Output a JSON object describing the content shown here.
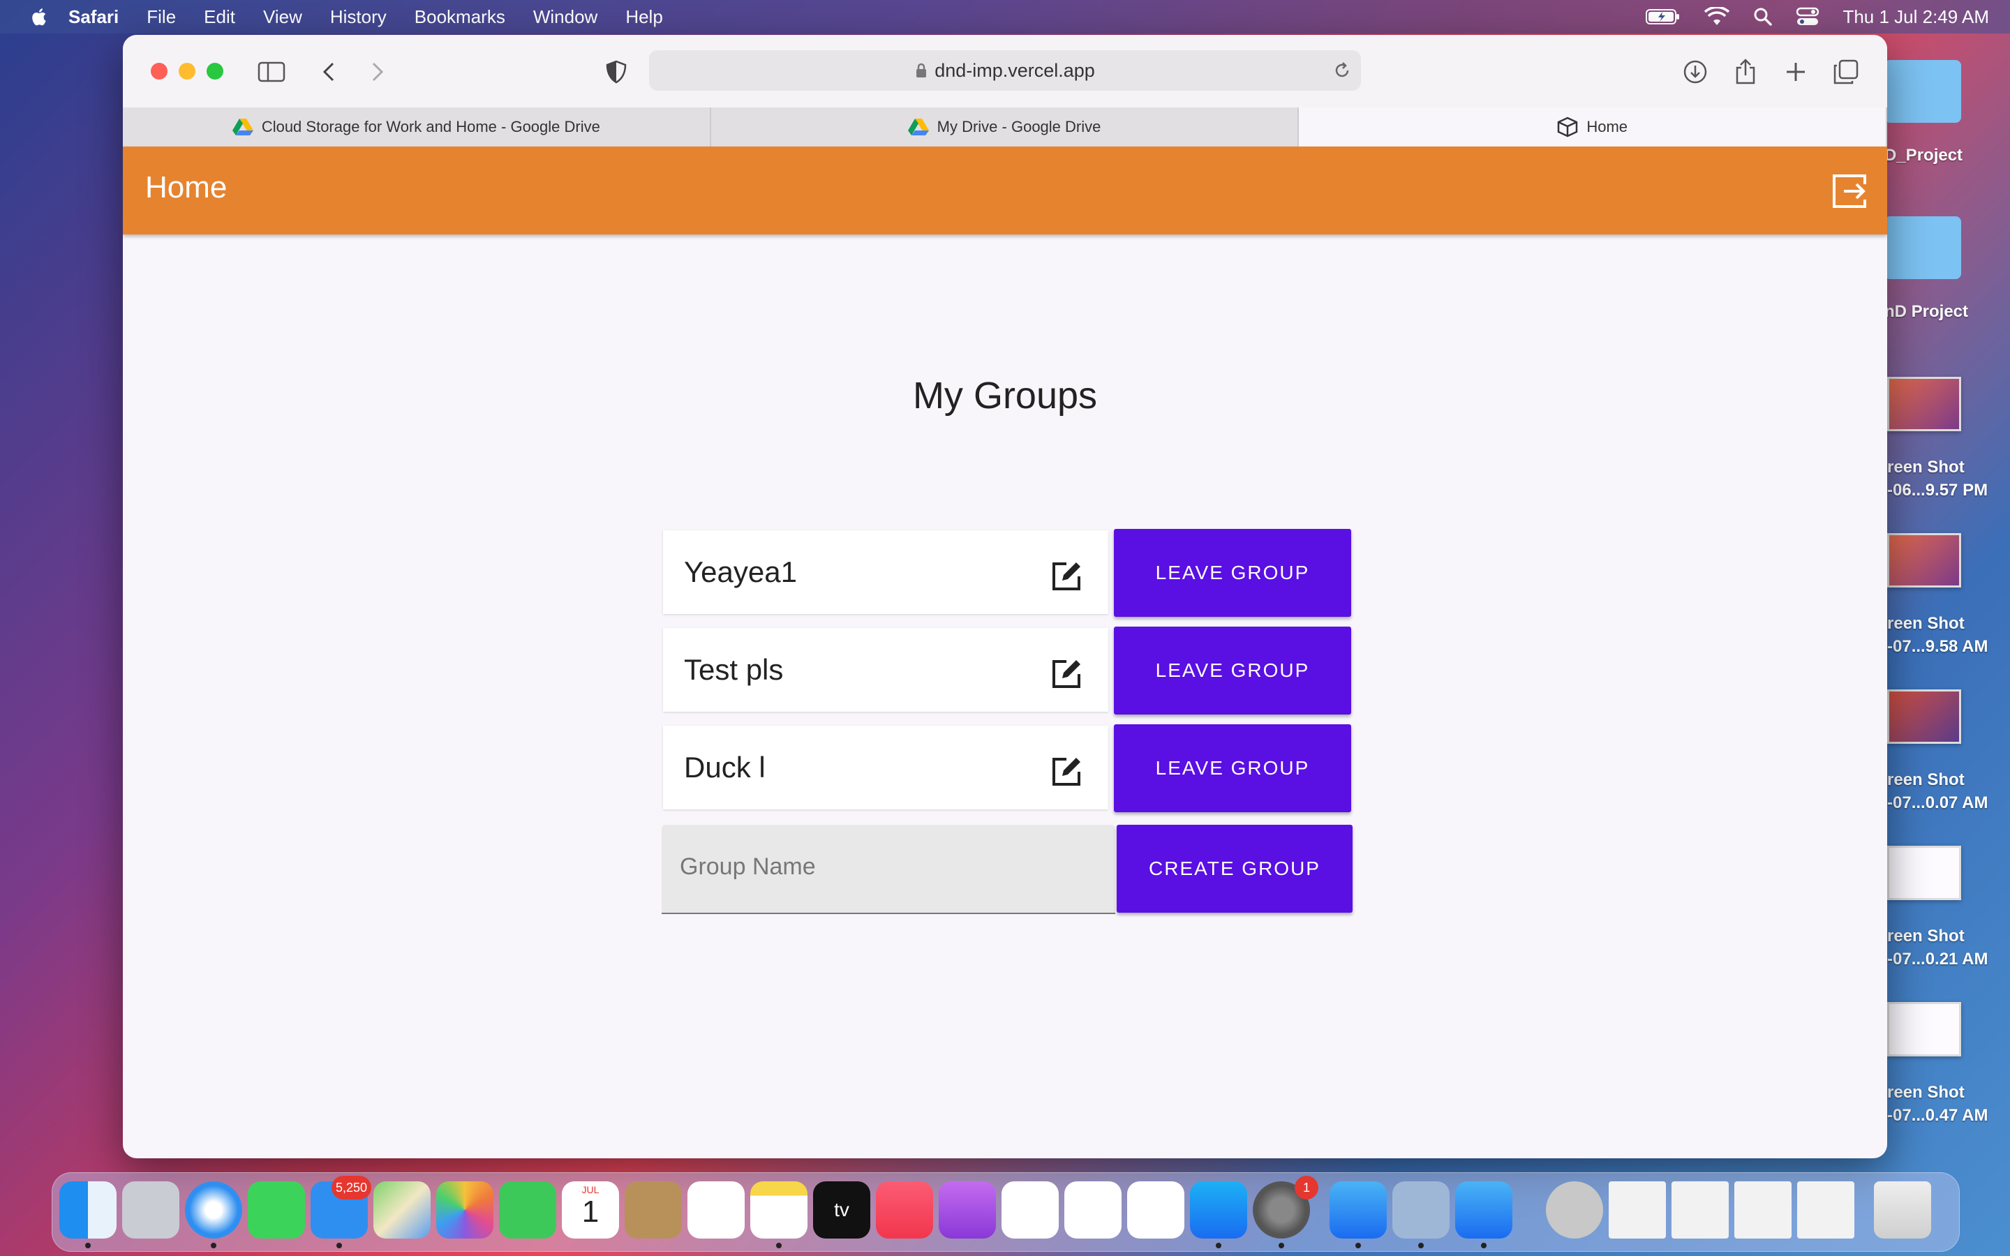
{
  "menubar": {
    "app_name": "Safari",
    "items": [
      "File",
      "Edit",
      "View",
      "History",
      "Bookmarks",
      "Window",
      "Help"
    ],
    "clock": "Thu 1 Jul  2:49 AM"
  },
  "desktop": {
    "items": [
      {
        "label": "D_Project"
      },
      {
        "label": "nD Project"
      },
      {
        "label": "reen Shot",
        "sub": "-06...9.57 PM"
      },
      {
        "label": "reen Shot",
        "sub": "-07...9.58 AM"
      },
      {
        "label": "reen Shot",
        "sub": "-07...0.07 AM"
      },
      {
        "label": "reen Shot",
        "sub": "-07...0.21 AM"
      },
      {
        "label": "reen Shot",
        "sub": "-07...0.47 AM"
      }
    ]
  },
  "browser": {
    "url": "dnd-imp.vercel.app",
    "tabs": [
      {
        "label": "Cloud Storage for Work and Home - Google Drive",
        "icon": "google-drive-icon"
      },
      {
        "label": "My Drive - Google Drive",
        "icon": "google-drive-icon"
      },
      {
        "label": "Home",
        "icon": "box-icon"
      }
    ]
  },
  "app": {
    "title": "Home",
    "heading": "My Groups",
    "groups": [
      {
        "name": "Yeayea1",
        "button": "LEAVE GROUP"
      },
      {
        "name": "Test pls",
        "button": "LEAVE GROUP"
      },
      {
        "name": "Duck l",
        "button": "LEAVE GROUP"
      }
    ],
    "create": {
      "placeholder": "Group Name",
      "button": "CREATE GROUP"
    },
    "colors": {
      "appbar": "#e6832f",
      "button": "#5a0fe3"
    }
  },
  "dock": {
    "mail_badge": "5,250",
    "calendar_month": "JUL",
    "calendar_day": "1",
    "settings_badge": "1",
    "tv_label": "tv"
  }
}
